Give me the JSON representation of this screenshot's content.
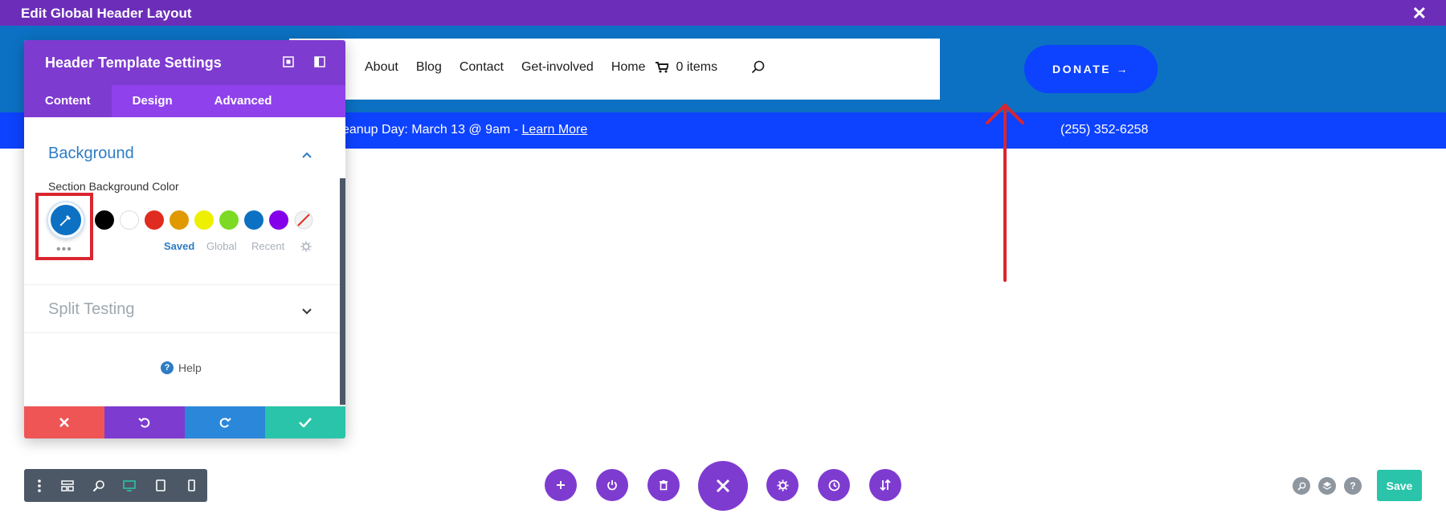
{
  "topbar": {
    "title": "Edit Global Header Layout",
    "close_icon": "close-icon"
  },
  "menu": {
    "items": [
      "About",
      "Blog",
      "Contact",
      "Get-involved",
      "Home"
    ],
    "cart_label": "0 items",
    "search_icon": "search-icon"
  },
  "donate": {
    "label": "DONATE →"
  },
  "announcement": {
    "text": "eanup Day: March 13 @ 9am - ",
    "link": "Learn More",
    "phone": "(255) 352-6258"
  },
  "panel": {
    "title": "Header Template Settings",
    "tabs": [
      "Content",
      "Design",
      "Advanced"
    ],
    "active_tab": "Content",
    "background_section": "Background",
    "section_bg_label": "Section Background Color",
    "picker_dots": "•••",
    "swatches": [
      "#000000",
      "#ffffff",
      "#e02b20",
      "#e09900",
      "#edf000",
      "#7cda24",
      "#0c71c3",
      "#8300e9"
    ],
    "palette_tabs": [
      "Saved",
      "Global",
      "Recent"
    ],
    "split_testing": "Split Testing",
    "help": "Help"
  },
  "save": {
    "label": "Save"
  },
  "colors": {
    "topbar": "#6c2eb9",
    "header": "#0c71c3",
    "brand_blue": "#0d42ff",
    "purple": "#7e3bd0",
    "teal": "#29c4a9",
    "red_annotation": "#d9262f"
  }
}
